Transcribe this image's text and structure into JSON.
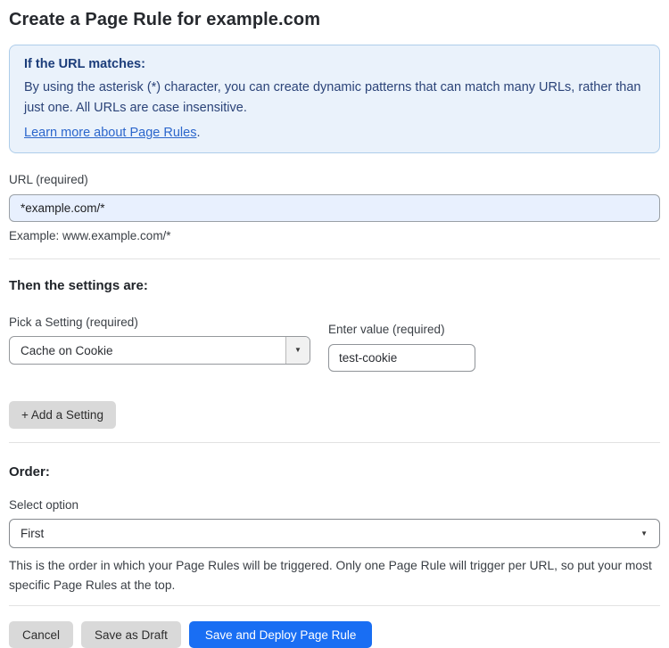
{
  "page": {
    "title": "Create a Page Rule for example.com"
  },
  "info_box": {
    "heading": "If the URL matches:",
    "body": "By using the asterisk (*) character, you can create dynamic patterns that can match many URLs, rather than just one. All URLs are case insensitive.",
    "link_label": "Learn more about Page Rules",
    "link_suffix": "."
  },
  "url_field": {
    "label": "URL (required)",
    "value": "*example.com/*",
    "helper": "Example: www.example.com/*"
  },
  "settings_section": {
    "heading": "Then the settings are:",
    "setting_label": "Pick a Setting (required)",
    "setting_value": "Cache on Cookie",
    "value_label": "Enter value (required)",
    "value_text": "test-cookie",
    "add_button_label": "+ Add a Setting"
  },
  "order_section": {
    "heading": "Order:",
    "select_label": "Select option",
    "select_value": "First",
    "helper": "This is the order in which your Page Rules will be triggered. Only one Page Rule will trigger per URL, so put your most specific Page Rules at the top."
  },
  "footer": {
    "cancel_label": "Cancel",
    "save_draft_label": "Save as Draft",
    "save_deploy_label": "Save and Deploy Page Rule"
  },
  "icons": {
    "dropdown_caret": "▼"
  },
  "colors": {
    "info_box_bg": "#eaf2fb",
    "info_box_border": "#aecdea",
    "info_text": "#2b4378",
    "link_blue": "#2b66cc",
    "url_input_bg": "#e8f0fe",
    "primary_button_blue": "#196ef3",
    "gray_button": "#d9d9d9"
  }
}
